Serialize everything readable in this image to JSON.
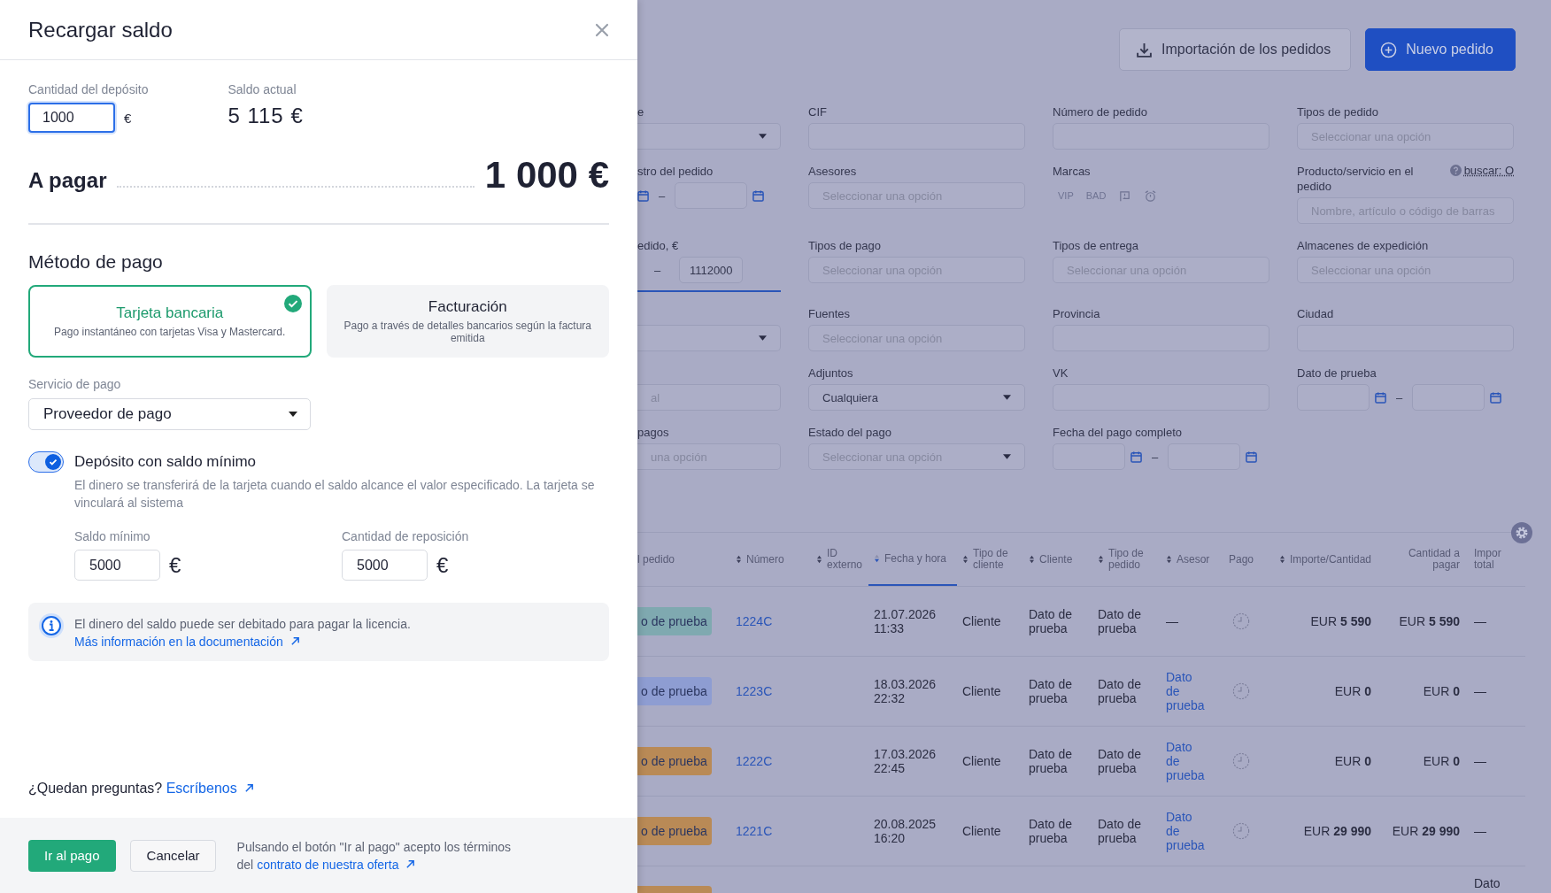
{
  "drawer": {
    "title": "Recargar saldo",
    "deposit": {
      "label": "Cantidad del depósito",
      "value": "1000",
      "currency": "€"
    },
    "balance": {
      "label": "Saldo actual",
      "value": "5 115 €"
    },
    "to_pay": {
      "label": "A pagar",
      "amount": "1 000 €"
    },
    "method_title": "Método de pago",
    "methods": [
      {
        "title": "Tarjeta bancaria",
        "description": "Pago instantáneo con tarjetas Visa y Mastercard.",
        "selected": true
      },
      {
        "title": "Facturación",
        "description": "Pago a través de detalles bancarios según la factura emitida",
        "selected": false
      }
    ],
    "service": {
      "label": "Servicio de pago",
      "value": "Proveedor de pago"
    },
    "min_deposit": {
      "label": "Depósito con saldo mínimo",
      "description": "El dinero se transferirá de la tarjeta cuando el saldo alcance el valor especificado. La tarjeta se vinculará al sistema",
      "on": true
    },
    "min_fields": [
      {
        "label": "Saldo mínimo",
        "value": "5000",
        "currency": "€"
      },
      {
        "label": "Cantidad de reposición",
        "value": "5000",
        "currency": "€"
      }
    ],
    "info": {
      "text": "El dinero del saldo puede ser debitado para pagar la licencia.",
      "link": "Más información en la documentación"
    },
    "questions": {
      "text": "¿Quedan preguntas?",
      "link": "Escríbenos"
    },
    "buttons": [
      {
        "label": "Ir al pago",
        "kind": "primary"
      },
      {
        "label": "Cancelar",
        "kind": "secondary"
      }
    ],
    "terms": {
      "text": "Pulsando el botón \"Ir al pago\" acepto los términos del",
      "link": "contrato de nuestra oferta"
    }
  },
  "page": {
    "actions": [
      {
        "label": "Importación de los pedidos",
        "kind": "import"
      },
      {
        "label": "Nuevo pedido",
        "kind": "new"
      }
    ],
    "filters": [
      {
        "label": "e",
        "kind": "select"
      },
      {
        "label": "CIF",
        "kind": "input"
      },
      {
        "label": "Número de pedido",
        "kind": "input"
      },
      {
        "label": "Tipos de pedido",
        "kind": "input",
        "placeholder": "Seleccionar una opción"
      },
      {
        "label": "stro del pedido",
        "kind": "date_range_cut",
        "separator": "–"
      },
      {
        "label": "Asesores",
        "kind": "input",
        "placeholder": "Seleccionar una opción"
      },
      {
        "label": "Marcas",
        "kind": "marks",
        "marks": [
          "VIP",
          "BAD"
        ]
      },
      {
        "label": "Producto/servicio en el pedido",
        "kind": "input",
        "placeholder": "Nombre, artículo o código de barras",
        "help": "buscar: O"
      },
      {
        "label": "edido, €",
        "kind": "range_cut",
        "separator": "–",
        "value": "1112000"
      },
      {
        "label": "Tipos de pago",
        "kind": "input",
        "placeholder": "Seleccionar una opción"
      },
      {
        "label": "Tipos de entrega",
        "kind": "input",
        "placeholder": "Seleccionar una opción"
      },
      {
        "label": "Almacenes de expedición",
        "kind": "input",
        "placeholder": "Seleccionar una opción"
      },
      {
        "kind": "select"
      },
      {
        "label": "Fuentes",
        "kind": "input",
        "placeholder": "Seleccionar una opción"
      },
      {
        "label": "Provincia",
        "kind": "input"
      },
      {
        "label": "Ciudad",
        "kind": "input"
      },
      {
        "kind": "input",
        "placeholder": "al"
      },
      {
        "label": "Adjuntos",
        "kind": "select",
        "value": "Cualquiera"
      },
      {
        "label": "VK",
        "kind": "input"
      },
      {
        "label": "Dato de prueba",
        "kind": "date_range",
        "separator": "–"
      },
      {
        "label": "pagos",
        "kind": "input",
        "placeholder": "una opción"
      },
      {
        "label": "Estado del pago",
        "kind": "select",
        "placeholder": "Seleccionar una opción"
      },
      {
        "label": "Fecha del pago completo",
        "kind": "date_range",
        "separator": "–"
      }
    ],
    "table": {
      "columns": [
        {
          "label": "l pedido",
          "sortable": false,
          "sorted": false
        },
        {
          "label": "Número",
          "sortable": true,
          "sorted": false
        },
        {
          "label": "ID externo",
          "sortable": true,
          "sorted": false
        },
        {
          "label": "Fecha y hora",
          "sortable": true,
          "sorted": true
        },
        {
          "label": "Tipo de cliente",
          "sortable": true,
          "sorted": false
        },
        {
          "label": "Cliente",
          "sortable": true,
          "sorted": false
        },
        {
          "label": "Tipo de pedido",
          "sortable": true,
          "sorted": false
        },
        {
          "label": "Asesor",
          "sortable": true,
          "sorted": false
        },
        {
          "label": "Pago",
          "sortable": false,
          "sorted": false
        },
        {
          "label": "Importe/Cantidad",
          "sortable": true,
          "sorted": false
        },
        {
          "label": "Cantidad a pagar",
          "sortable": false,
          "sorted": false
        },
        {
          "label": "Impor total",
          "sortable": false,
          "sorted": false
        }
      ],
      "rows": [
        {
          "kind": "full",
          "status": {
            "text": "o de prueba",
            "color": "#7fa9b0"
          },
          "number": "1224C",
          "date": "21.07.2026 11:33",
          "client_type": "Cliente",
          "client": "Dato de prueba",
          "order_type": "Dato de prueba",
          "advisor": {
            "text": "—",
            "kind": "plain"
          },
          "amount": "EUR **5 590**",
          "to_pay": "EUR **5 590**",
          "total": "—"
        },
        {
          "kind": "full",
          "status": {
            "text": "o de prueba",
            "color": "#8e9dd2"
          },
          "number": "1223C",
          "date": "18.03.2026 22:32",
          "client_type": "Cliente",
          "client": "Dato de prueba",
          "order_type": "Dato de prueba",
          "advisor": {
            "text": "Dato de prueba",
            "kind": "link"
          },
          "amount": "EUR **0**",
          "to_pay": "EUR **0**",
          "total": "—"
        },
        {
          "kind": "full",
          "status": {
            "text": "o de prueba",
            "color": "#b98a56"
          },
          "number": "1222C",
          "date": "17.03.2026 22:45",
          "client_type": "Cliente",
          "client": "Dato de prueba",
          "order_type": "Dato de prueba",
          "advisor": {
            "text": "Dato de prueba",
            "kind": "link"
          },
          "amount": "EUR **0**",
          "to_pay": "EUR **0**",
          "total": "—"
        },
        {
          "kind": "full",
          "status": {
            "text": "o de prueba",
            "color": "#b98a56"
          },
          "number": "1221C",
          "date": "20.08.2025 16:20",
          "client_type": "Cliente",
          "client": "Dato de prueba",
          "order_type": "Dato de prueba",
          "advisor": {
            "text": "Dato de prueba",
            "kind": "link"
          },
          "amount": "EUR **29 990**",
          "to_pay": "EUR **29 990**",
          "total": "—"
        },
        {
          "kind": "partial",
          "status": {
            "color": "#b98a56"
          },
          "total": "Dato"
        }
      ]
    }
  }
}
